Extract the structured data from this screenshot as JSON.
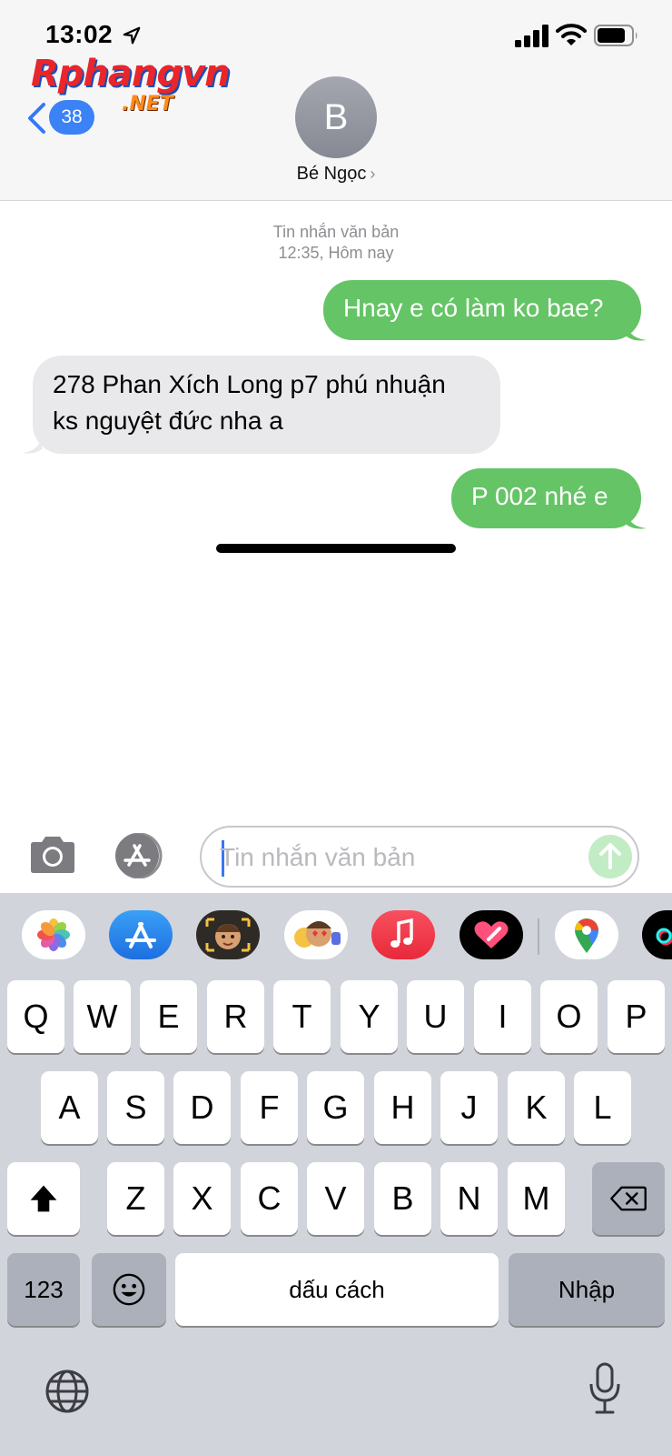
{
  "status_bar": {
    "time": "13:02",
    "icons": [
      "location-arrow-icon",
      "cellular-signal-icon",
      "wifi-icon",
      "battery-icon"
    ]
  },
  "watermark": {
    "main": "Rphangvn",
    "sub": ".NET"
  },
  "nav": {
    "back_badge": "38",
    "avatar_initial": "B",
    "contact_name": "Bé Ngọc",
    "contact_chevron": "›"
  },
  "conversation": {
    "service_label": "Tin nhắn văn bản",
    "timestamp": "12:35, Hôm nay",
    "messages": [
      {
        "direction": "sent",
        "text": "Hnay e có làm ko bae?"
      },
      {
        "direction": "received",
        "line1": "278 Phan Xích Long p7 phú nhuận",
        "line2": "ks nguyệt đức nha a"
      },
      {
        "direction": "sent",
        "text": "P 002 nhé e"
      }
    ]
  },
  "composer": {
    "placeholder": "Tin nhắn văn bản",
    "value": ""
  },
  "app_drawer": {
    "apps": [
      "photos-icon",
      "app-store-icon",
      "memoji-icon",
      "animoji-icon",
      "music-icon",
      "digital-touch-icon",
      "google-maps-icon",
      "tiktok-icon"
    ]
  },
  "keyboard": {
    "row1": [
      "Q",
      "W",
      "E",
      "R",
      "T",
      "Y",
      "U",
      "I",
      "O",
      "P"
    ],
    "row2": [
      "A",
      "S",
      "D",
      "F",
      "G",
      "H",
      "J",
      "K",
      "L"
    ],
    "row3": [
      "Z",
      "X",
      "C",
      "V",
      "B",
      "N",
      "M"
    ],
    "numbers_key": "123",
    "space_key": "dấu cách",
    "return_key": "Nhập"
  },
  "colors": {
    "sent_bubble": "#65c466",
    "received_bubble": "#e9e9eb",
    "accent_blue": "#3b82f6",
    "keyboard_bg": "#d1d4da"
  }
}
